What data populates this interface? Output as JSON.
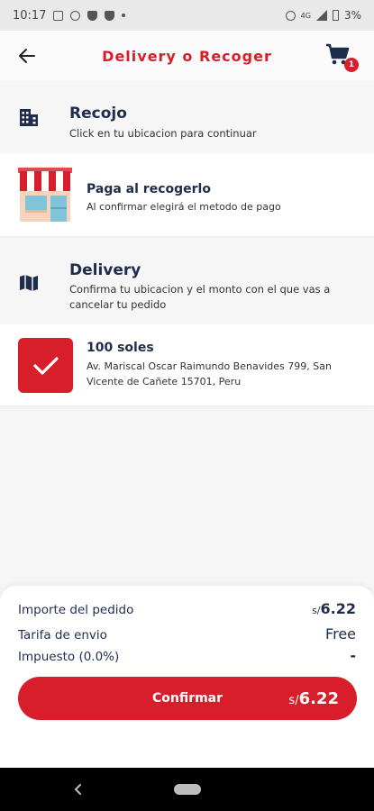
{
  "status_bar": {
    "time": "10:17",
    "network": "4G",
    "battery": "3%"
  },
  "header": {
    "title": "Delivery o Recoger",
    "cart_count": "1"
  },
  "recojo": {
    "title": "Recojo",
    "subtitle": "Click en tu ubicacion para continuar"
  },
  "pickup_option": {
    "title": "Paga al recogerlo",
    "subtitle": "Al confirmar elegirá el metodo de pago"
  },
  "delivery": {
    "title": "Delivery",
    "subtitle": "Confirma tu ubicacion y el monto con el que vas a cancelar tu pedido"
  },
  "address_option": {
    "title": "100 soles",
    "address": "Av. Mariscal Oscar Raimundo Benavides 799, San Vicente de Cañete 15701, Peru"
  },
  "summary": {
    "order_label": "Importe del pedido",
    "currency": "s/",
    "order_value": "6.22",
    "shipping_label": "Tarifa de envio",
    "shipping_value": "Free",
    "tax_label": "Impuesto (0.0%)",
    "tax_value": "-"
  },
  "confirm": {
    "label": "Confirmar",
    "currency": "s/",
    "total": "6.22"
  },
  "colors": {
    "accent": "#d71e2a",
    "text": "#1f2d4d"
  }
}
